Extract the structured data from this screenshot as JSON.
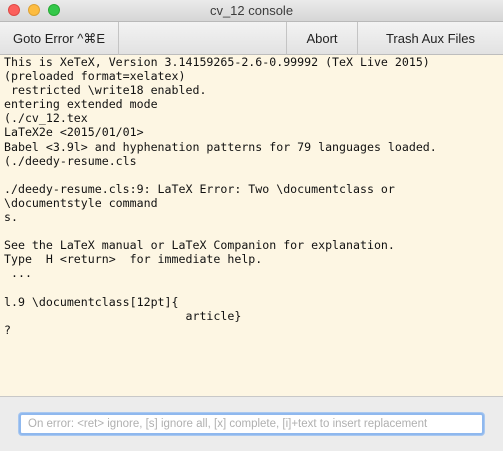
{
  "window": {
    "title": "cv_12 console"
  },
  "toolbar": {
    "goto_error": "Goto Error ^⌘E",
    "abort": "Abort",
    "trash_aux": "Trash Aux Files"
  },
  "console": {
    "lines": [
      "This is XeTeX, Version 3.14159265-2.6-0.99992 (TeX Live 2015)",
      "(preloaded format=xelatex)",
      " restricted \\write18 enabled.",
      "entering extended mode",
      "(./cv_12.tex",
      "LaTeX2e <2015/01/01>",
      "Babel <3.9l> and hyphenation patterns for 79 languages loaded.",
      "(./deedy-resume.cls",
      "",
      "./deedy-resume.cls:9: LaTeX Error: Two \\documentclass or",
      "\\documentstyle command",
      "s.",
      "",
      "See the LaTeX manual or LaTeX Companion for explanation.",
      "Type  H <return>  for immediate help.",
      " ...",
      "",
      "l.9 \\documentclass[12pt]{",
      "                          article}",
      "?"
    ]
  },
  "input": {
    "value": "",
    "placeholder": "On error: <ret> ignore, [s] ignore all, [x] complete, [i]+text to insert replacement"
  }
}
